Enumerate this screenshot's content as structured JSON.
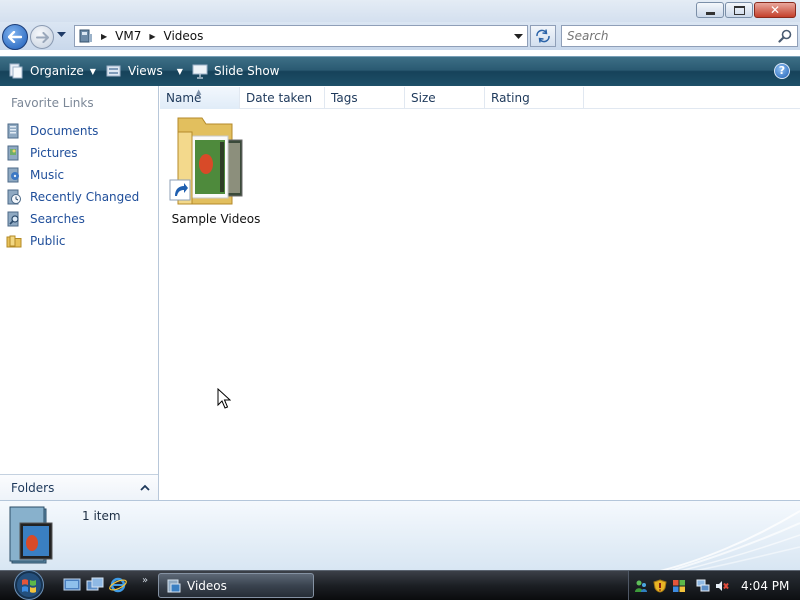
{
  "address": {
    "crumbs": [
      "VM7",
      "Videos"
    ],
    "search_placeholder": "Search"
  },
  "toolbar": {
    "organize": "Organize",
    "views": "Views",
    "slideshow": "Slide Show"
  },
  "nav": {
    "favorite_links_title": "Favorite Links",
    "items": [
      {
        "label": "Documents",
        "icon": "documents-icon"
      },
      {
        "label": "Pictures",
        "icon": "pictures-icon"
      },
      {
        "label": "Music",
        "icon": "music-icon"
      },
      {
        "label": "Recently Changed",
        "icon": "recently-changed-icon"
      },
      {
        "label": "Searches",
        "icon": "searches-icon"
      },
      {
        "label": "Public",
        "icon": "public-folder-icon"
      }
    ],
    "folders_label": "Folders"
  },
  "columns": [
    "Name",
    "Date taken",
    "Tags",
    "Size",
    "Rating"
  ],
  "files": [
    {
      "name": "Sample Videos",
      "icon": "folder-shortcut-icon"
    }
  ],
  "details": {
    "item_count": "1 item"
  },
  "taskbar": {
    "active_window": "Videos",
    "clock": "4:04 PM"
  },
  "colors": {
    "command_bar": "#2a5a72",
    "link_blue": "#1f4e9a",
    "taskbar": "#1c1f24"
  }
}
